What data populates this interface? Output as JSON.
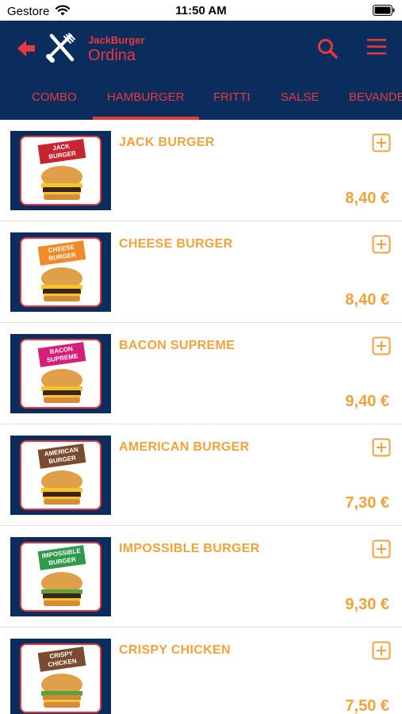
{
  "status_bar": {
    "carrier": "Gestore",
    "time": "11:50 AM"
  },
  "header": {
    "subtitle": "JackBurger",
    "title": "Ordina"
  },
  "tabs": [
    {
      "label": "COMBO"
    },
    {
      "label": "HAMBURGER"
    },
    {
      "label": "FRITTI"
    },
    {
      "label": "SALSE"
    },
    {
      "label": "BEVANDE"
    }
  ],
  "selected_tab": "HAMBURGER",
  "products": [
    {
      "name": "JACK BURGER",
      "price": "8,40 €",
      "box_label": "JACK BURGER",
      "box_color": "#c7252f"
    },
    {
      "name": "CHEESE BURGER",
      "price": "8,40 €",
      "box_label": "CHEESE BURGER",
      "box_color": "#f08a2a"
    },
    {
      "name": "BACON SUPREME",
      "price": "9,40 €",
      "box_label": "BACON SUPREME",
      "box_color": "#d61f7a"
    },
    {
      "name": "AMERICAN BURGER",
      "price": "7,30 €",
      "box_label": "AMERICAN BURGER",
      "box_color": "#7a4b2e"
    },
    {
      "name": "IMPOSSIBLE BURGER",
      "price": "9,30 €",
      "box_label": "IMPOSSIBLE BURGER",
      "box_color": "#2e9a4a"
    },
    {
      "name": "CRISPY CHICKEN",
      "price": "7,50 €",
      "box_label": "CRISPY CHICKEN",
      "box_color": "#7a4b2e"
    }
  ],
  "colors": {
    "header_bg": "#0b2d5e",
    "accent_red": "#e63a3a",
    "accent_orange": "#f2a23a"
  },
  "icons": {
    "back": "arrow-left-icon",
    "logo": "fork-knife-icon",
    "search": "search-icon",
    "menu": "hamburger-menu-icon",
    "add": "plus-square-icon"
  }
}
